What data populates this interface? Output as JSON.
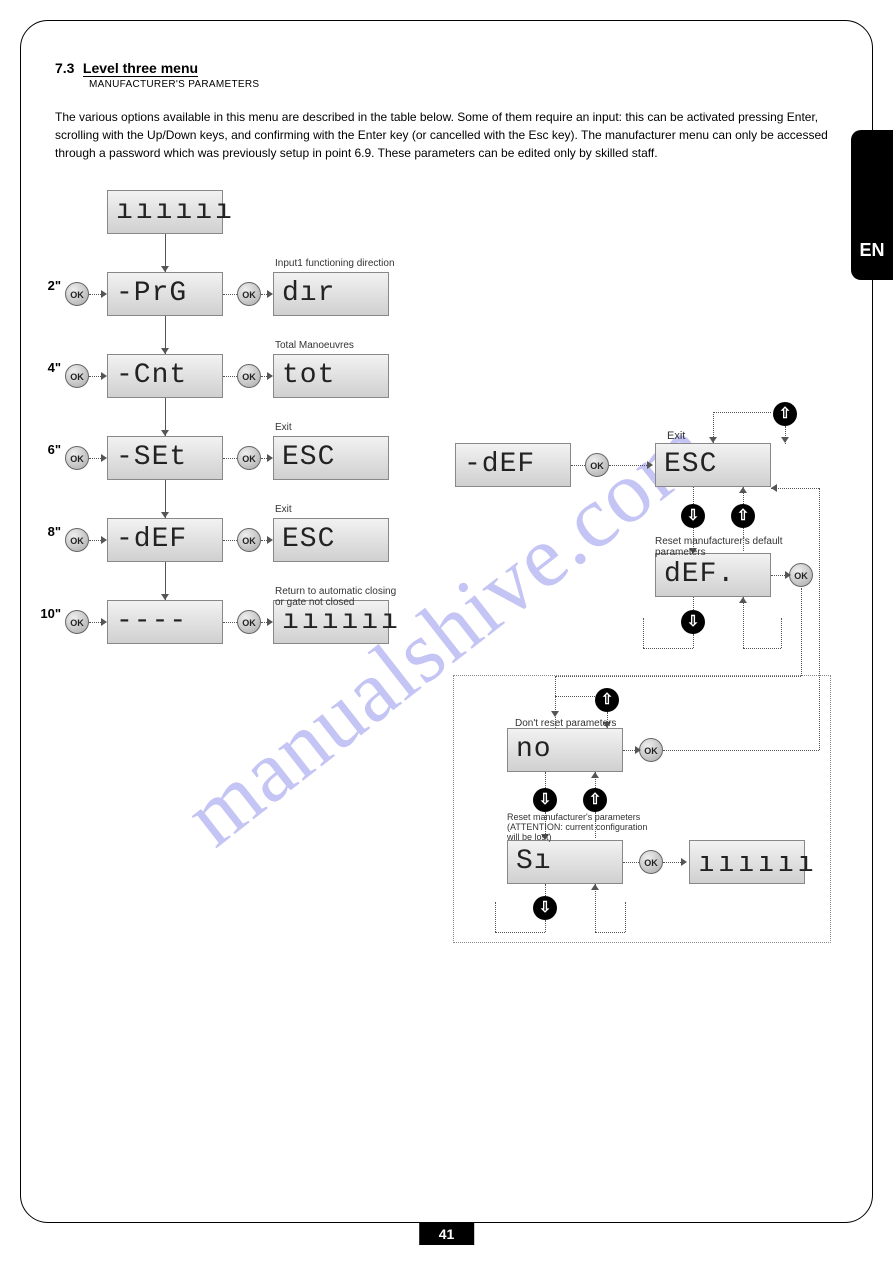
{
  "page": {
    "lang_tab": "EN",
    "page_number": "41"
  },
  "section": {
    "number": "7.3",
    "title": "Level three menu",
    "subtitle": "MANUFACTURER'S PARAMETERS",
    "paragraph": "The various options available in this menu are described in the table below. Some of them require an input: this can be activated pressing Enter, scrolling with the Up/Down keys, and confirming with the Enter key (or cancelled with the Esc key). The manufacturer menu can only be accessed through a password which was previously setup in point 6.9. These parameters can be edited only by skilled staff."
  },
  "left_flow": {
    "rows": [
      {
        "time": "",
        "left": "ıııııı",
        "right": "",
        "label": ""
      },
      {
        "time": "2\"",
        "left": "-PrG",
        "right": "dır",
        "label": "Input1 functioning direction"
      },
      {
        "time": "4\"",
        "left": "-Cnt",
        "right": "tot",
        "label": "Total Manoeuvres"
      },
      {
        "time": "6\"",
        "left": "-SEt",
        "right": "ESC",
        "label": "Exit"
      },
      {
        "time": "8\"",
        "left": "-dEF",
        "right": "ESC",
        "label": "Exit"
      },
      {
        "time": "10\"",
        "left": "----",
        "right": "ıııııı",
        "label": "Return to automatic closing\n or gate not closed"
      }
    ],
    "ok_label": "OK"
  },
  "right_flow": {
    "start": "-dEF",
    "esc": "ESC",
    "def": "dEF.",
    "no_box": "no",
    "si_box": "Sı",
    "bars": "ıııııı",
    "ok_label": "OK",
    "lbl_exit": "Exit",
    "lbl_reset_default": "Reset manufacturer's default\n parameters",
    "lbl_dont_reset": "Don't reset parameters",
    "lbl_notice": "Reset manufacturer's parameters\n(ATTENTION: current configuration\nwill be lost)"
  },
  "watermark": "manualshive.com"
}
